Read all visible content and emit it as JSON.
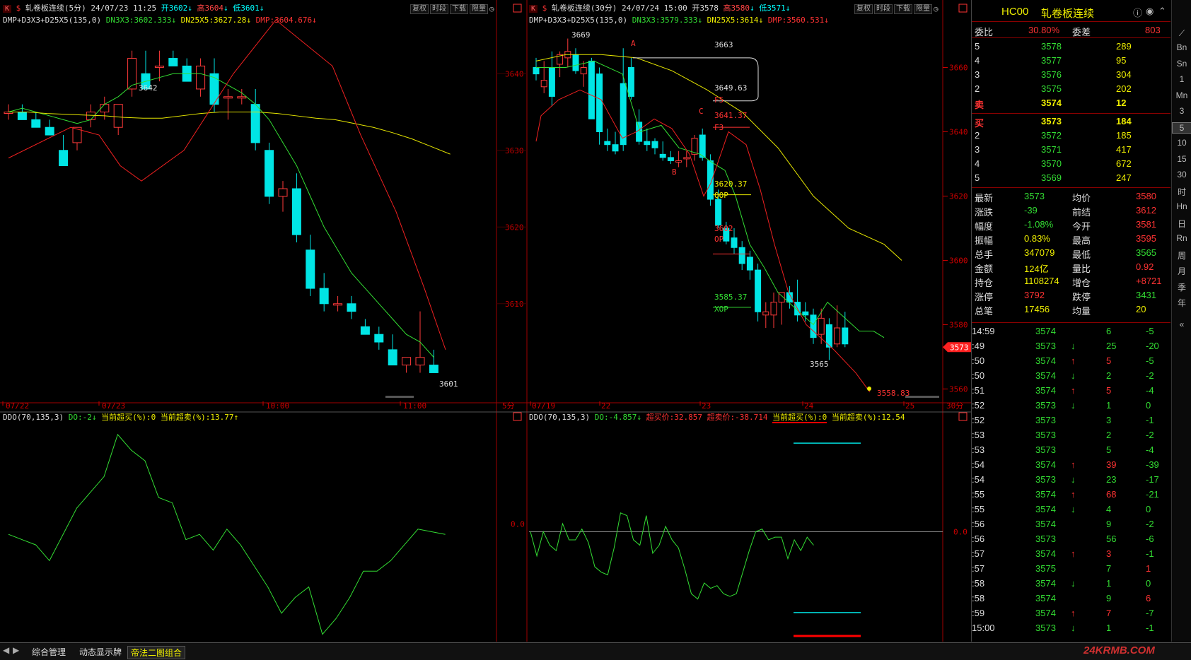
{
  "colors": {
    "up": "#ff3a3a",
    "down": "#00e5e5",
    "ma_green": "#33dd33",
    "ma_yellow": "#e6e600",
    "ma_red": "#ee2020",
    "axis": "#a00000",
    "ddo": "#33dd33"
  },
  "left": {
    "badge": "K",
    "title": "轧卷板连续(5分)",
    "date": "24/07/23 11:25",
    "open": "开3602",
    "high": "高3604",
    "low": "低3601",
    "arrow_up": "↑",
    "arrow_down": "↓",
    "buttons": [
      "复权",
      "时段",
      "下载",
      "限量"
    ],
    "indicator": "DMP+D3X3+D25X5(135,0)",
    "dn3": "DN3X3:3602.333",
    "dn25": "DN25X5:3627.28",
    "dmp": "DMP:3604.676",
    "axis_labels": [
      "3640",
      "3630",
      "3620",
      "3610"
    ],
    "price_notes": [
      "3642",
      "3601"
    ],
    "time_labels": [
      "07/22",
      "07/23",
      "10:00",
      "11:00"
    ],
    "period": "5分",
    "ddo_label": "DDO(70,135,3)",
    "ddo_do": "DO:-2",
    "ddo_buy": "当前超买(%):0",
    "ddo_sell": "当前超卖(%):13.77",
    "ddo_zero": "0.0"
  },
  "right": {
    "badge": "K",
    "title": "轧卷板连续(30分)",
    "date": "24/07/24 15:00",
    "open": "开3578",
    "high": "高3580",
    "low": "低3571",
    "buttons": [
      "复权",
      "时段",
      "下载",
      "限量"
    ],
    "indicator": "DMP+D3X3+D25X5(135,0)",
    "dn3": "DN3X3:3579.333",
    "dn25": "DN25X5:3614",
    "dmp": "DMP:3560.531",
    "axis_labels": [
      "3660",
      "3640",
      "3620",
      "3600",
      "3580",
      "3560"
    ],
    "current_price": "3573",
    "annotations": [
      "3669",
      "3663",
      "3649.63",
      "F5",
      "3641.37",
      "F3",
      "C",
      "A",
      "B",
      "3620.37",
      "QOP",
      "3602",
      "OP",
      "3585.37",
      "XOP",
      "3565",
      "3558.83"
    ],
    "time_labels": [
      "07/19",
      "22",
      "23",
      "24",
      "25"
    ],
    "period": "30分",
    "ddo_label": "DDO(70,135,3)",
    "ddo_do": "DO:-4.857",
    "ddo_overbuy": "超买价:32.857",
    "ddo_oversell": "超卖价:-38.714",
    "ddo_buy": "当前超买(%):0",
    "ddo_sell": "当前超卖(%):12.54",
    "ddo_zero": "0.0"
  },
  "quote": {
    "symbol": "HC00",
    "name": "轧卷板连续",
    "weibi_label": "委比",
    "weibi": "30.80%",
    "weicha_label": "委差",
    "weicha": "803",
    "asks": [
      [
        "5",
        "3578",
        "289"
      ],
      [
        "4",
        "3577",
        "95"
      ],
      [
        "3",
        "3576",
        "304"
      ],
      [
        "2",
        "3575",
        "202"
      ],
      [
        "卖",
        "3574",
        "12"
      ]
    ],
    "bids": [
      [
        "买",
        "3573",
        "184"
      ],
      [
        "2",
        "3572",
        "185"
      ],
      [
        "3",
        "3571",
        "417"
      ],
      [
        "4",
        "3570",
        "672"
      ],
      [
        "5",
        "3569",
        "247"
      ]
    ],
    "stats": [
      [
        "最新",
        "3573",
        "均价",
        "3580"
      ],
      [
        "涨跌",
        "-39",
        "前结",
        "3612"
      ],
      [
        "幅度",
        "-1.08%",
        "今开",
        "3581"
      ],
      [
        "振幅",
        "0.83%",
        "最高",
        "3595"
      ],
      [
        "总手",
        "347079",
        "最低",
        "3565"
      ],
      [
        "金额",
        "124亿",
        "量比",
        "0.92"
      ],
      [
        "持仓",
        "1108274",
        "增仓",
        "+8721"
      ],
      [
        "涨停",
        "3792",
        "跌停",
        "3431"
      ],
      [
        "总笔",
        "17456",
        "均量",
        "20"
      ]
    ],
    "ticks": [
      [
        "14:59",
        "3574",
        "",
        "6",
        "-5"
      ],
      [
        ":49",
        "3573",
        "↓",
        "25",
        "-20"
      ],
      [
        ":50",
        "3574",
        "↑",
        "5",
        "-5"
      ],
      [
        ":50",
        "3574",
        "↓",
        "2",
        "-2"
      ],
      [
        ":51",
        "3574",
        "↑",
        "5",
        "-4"
      ],
      [
        ":52",
        "3573",
        "↓",
        "1",
        "0"
      ],
      [
        ":52",
        "3573",
        "",
        "3",
        "-1"
      ],
      [
        ":53",
        "3573",
        "",
        "2",
        "-2"
      ],
      [
        ":53",
        "3573",
        "",
        "5",
        "-4"
      ],
      [
        ":54",
        "3574",
        "↑",
        "39",
        "-39"
      ],
      [
        ":54",
        "3573",
        "↓",
        "23",
        "-17"
      ],
      [
        ":55",
        "3574",
        "↑",
        "68",
        "-21"
      ],
      [
        ":55",
        "3574",
        "↓",
        "4",
        "0"
      ],
      [
        ":56",
        "3574",
        "",
        "9",
        "-2"
      ],
      [
        ":56",
        "3573",
        "",
        "56",
        "-6"
      ],
      [
        ":57",
        "3574",
        "↑",
        "3",
        "-1"
      ],
      [
        ":57",
        "3575",
        "",
        "7",
        "1"
      ],
      [
        ":58",
        "3574",
        "↓",
        "1",
        "0"
      ],
      [
        ":58",
        "3574",
        "",
        "9",
        "6"
      ],
      [
        ":59",
        "3574",
        "↑",
        "7",
        "-7"
      ],
      [
        "15:00",
        "3573",
        "↓",
        "1",
        "-1"
      ]
    ]
  },
  "toolbar": [
    "Bn",
    "Sn",
    "1",
    "Mn",
    "3",
    "5",
    "10",
    "15",
    "30",
    "时",
    "Hn",
    "日",
    "Rn",
    "周",
    "月",
    "季",
    "年"
  ],
  "tabs": [
    "综合管理",
    "动态显示牌",
    "帝法二图组合"
  ],
  "watermark": "24KRMB.COM"
}
